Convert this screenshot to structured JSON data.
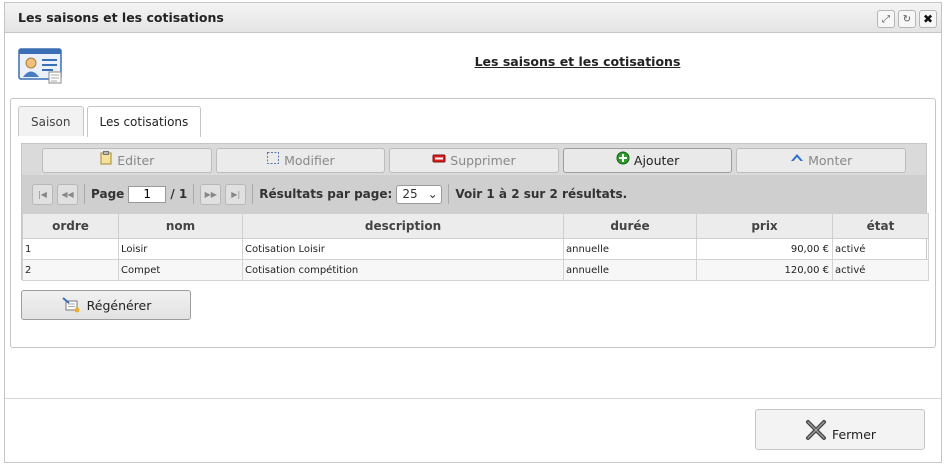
{
  "window": {
    "title": "Les saisons et les cotisations",
    "buttons": [
      "maximize-icon",
      "refresh-icon",
      "close-icon"
    ]
  },
  "header": {
    "heading": "Les saisons et les cotisations",
    "icon": "id-card-icon"
  },
  "tabs": [
    {
      "label": "Saison",
      "active": false
    },
    {
      "label": "Les cotisations",
      "active": true
    }
  ],
  "toolbar": {
    "edit_label": "Editer",
    "modify_label": "Modifier",
    "delete_label": "Supprimer",
    "add_label": "Ajouter",
    "up_label": "Monter"
  },
  "pager": {
    "page_label": "Page",
    "page_value": "1",
    "total_pages": "/ 1",
    "rpp_label": "Résultats par page:",
    "rpp_value": "25",
    "summary": "Voir 1 à 2 sur 2 résultats."
  },
  "table": {
    "columns": [
      "ordre",
      "nom",
      "description",
      "durée",
      "prix",
      "état"
    ],
    "rows": [
      [
        "1",
        "Loisir",
        "Cotisation Loisir",
        "annuelle",
        "90,00 €",
        "activé"
      ],
      [
        "2",
        "Compet",
        "Cotisation compétition",
        "annuelle",
        "120,00 €",
        "activé"
      ]
    ]
  },
  "actions": {
    "regenerate_label": "Régénérer",
    "close_label": "Fermer"
  },
  "colors": {
    "titlebar": "#e4e4e4",
    "toolbar": "#dadada",
    "pager": "#cfcfcf",
    "add_icon": "#2a9d2a",
    "delete_icon": "#d42020",
    "up_icon": "#2c6fd1"
  }
}
